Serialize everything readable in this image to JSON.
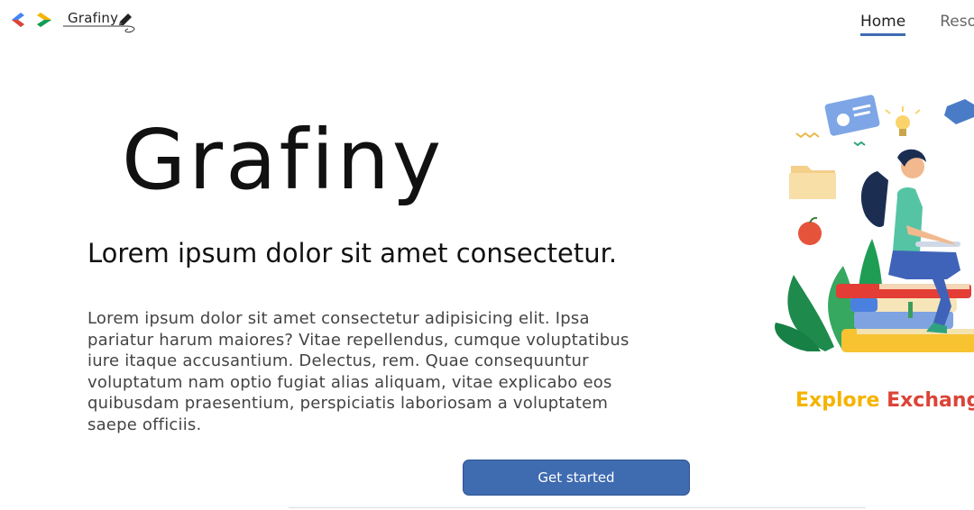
{
  "header": {
    "brand_name": "Grafiny",
    "nav": [
      {
        "label": "Home",
        "active": true
      },
      {
        "label": "Reso",
        "active": false
      }
    ]
  },
  "hero": {
    "title": "Grafiny",
    "subtitle": "Lorem ipsum dolor sit amet consectetur.",
    "body": "Lorem ipsum dolor sit amet consectetur adipisicing elit. Ipsa pariatur harum maiores? Vitae repellendus, cumque voluptatibus iure itaque accusantium. Delectus, rem. Quae consequuntur voluptatum nam optio fugiat alias aliquam, vitae explicabo eos quibusdam praesentium, perspiciatis laboriosam a voluptatem saepe officiis.",
    "cta_label": "Get started"
  },
  "explore": {
    "word1": "Explore",
    "word2": "Exchange"
  },
  "colors": {
    "accent": "#3f6bb0",
    "yellow": "#f4b400",
    "red": "#db4437",
    "green": "#0f9d58"
  }
}
